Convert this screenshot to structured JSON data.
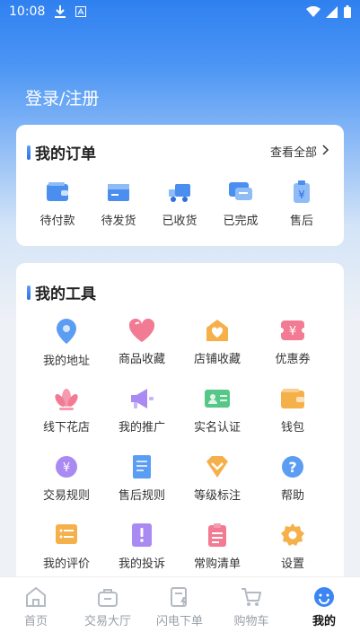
{
  "status_bar": {
    "time": "10:08"
  },
  "header": {
    "login_label": "登录/注册"
  },
  "orders": {
    "title": "我的订单",
    "view_all": "查看全部",
    "items": [
      {
        "label": "待付款",
        "icon": "wallet-icon"
      },
      {
        "label": "待发货",
        "icon": "package-icon"
      },
      {
        "label": "已收货",
        "icon": "truck-icon"
      },
      {
        "label": "已完成",
        "icon": "chat-icon"
      },
      {
        "label": "售后",
        "icon": "after-sale-icon"
      }
    ]
  },
  "tools": {
    "title": "我的工具",
    "items": [
      {
        "label": "我的地址",
        "icon": "location-icon"
      },
      {
        "label": "商品收藏",
        "icon": "heart-icon"
      },
      {
        "label": "店铺收藏",
        "icon": "store-heart-icon"
      },
      {
        "label": "优惠券",
        "icon": "coupon-icon"
      },
      {
        "label": "线下花店",
        "icon": "lotus-icon"
      },
      {
        "label": "我的推广",
        "icon": "megaphone-icon"
      },
      {
        "label": "实名认证",
        "icon": "id-card-icon"
      },
      {
        "label": "钱包",
        "icon": "wallet-icon"
      },
      {
        "label": "交易规则",
        "icon": "yen-coin-icon"
      },
      {
        "label": "售后规则",
        "icon": "document-icon"
      },
      {
        "label": "等级标注",
        "icon": "diamond-icon"
      },
      {
        "label": "帮助",
        "icon": "help-icon"
      },
      {
        "label": "我的评价",
        "icon": "list-icon"
      },
      {
        "label": "我的投诉",
        "icon": "complaint-icon"
      },
      {
        "label": "常购清单",
        "icon": "clipboard-icon"
      },
      {
        "label": "设置",
        "icon": "settings-icon"
      }
    ]
  },
  "tabbar": {
    "items": [
      {
        "label": "首页",
        "icon": "home-icon",
        "active": false
      },
      {
        "label": "交易大厅",
        "icon": "bag-icon",
        "active": false
      },
      {
        "label": "闪电下单",
        "icon": "flash-order-icon",
        "active": false
      },
      {
        "label": "购物车",
        "icon": "cart-icon",
        "active": false
      },
      {
        "label": "我的",
        "icon": "smile-icon",
        "active": true
      }
    ]
  },
  "colors": {
    "accent": "#2f80f0",
    "icon_blue": "#4a8ff0",
    "icon_pink": "#f06a86",
    "icon_orange": "#f2a23a",
    "icon_purple": "#9b6cf0",
    "icon_green": "#45c27a"
  }
}
